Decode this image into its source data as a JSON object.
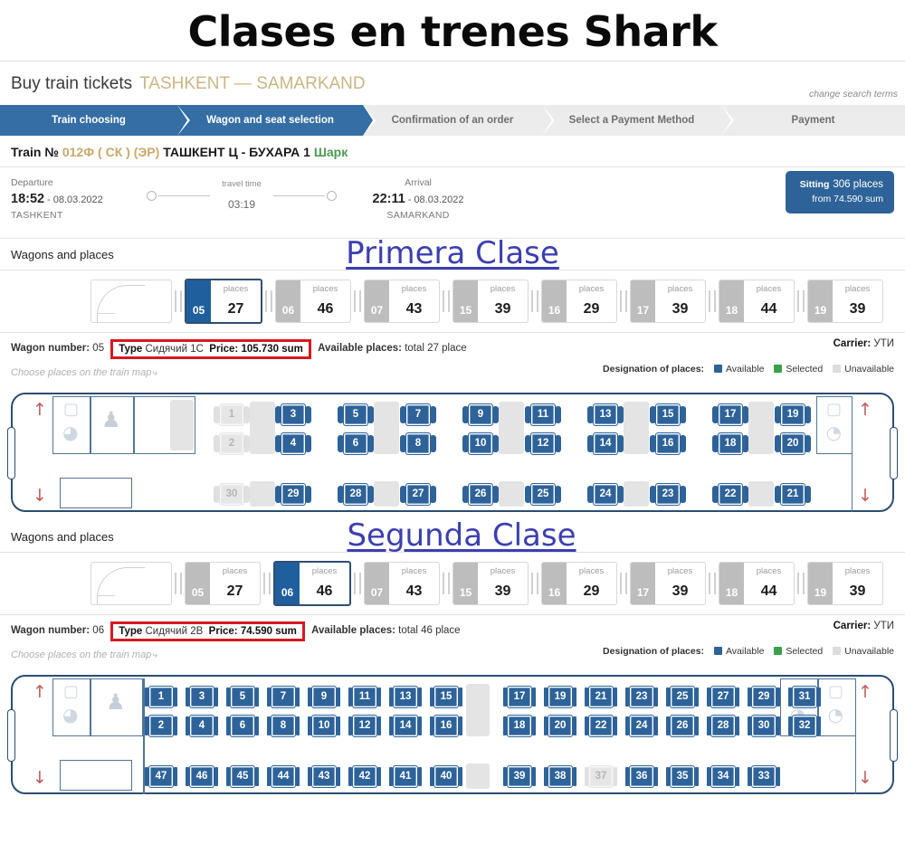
{
  "hero_title": "Clases en trenes Shark",
  "header": {
    "buy_label": "Buy train tickets",
    "route": "TASHKENT — SAMARKAND",
    "change_search": "change search terms"
  },
  "stepper": {
    "steps": [
      {
        "label": "Train choosing",
        "active": true
      },
      {
        "label": "Wagon and seat selection",
        "active": true
      },
      {
        "label": "Confirmation of an order",
        "active": false
      },
      {
        "label": "Select a Payment Method",
        "active": false
      },
      {
        "label": "Payment",
        "active": false
      }
    ]
  },
  "train": {
    "prefix": "Train №",
    "number": "012Ф ( СК ) (ЭР)",
    "route": "ТАШКЕНТ Ц - БУХАРА 1",
    "brand": "Шарк"
  },
  "schedule": {
    "departure_label": "Departure",
    "departure_time": "18:52",
    "departure_date": "- 08.03.2022",
    "departure_city": "TASHKENT",
    "travel_label": "travel time",
    "travel_time": "03:19",
    "arrival_label": "Arrival",
    "arrival_time": "22:11",
    "arrival_date": "- 08.03.2022",
    "arrival_city": "SAMARKAND",
    "badge_type": "Sitting",
    "badge_places": "306 places",
    "badge_price": "from 74.590 sum"
  },
  "legend": {
    "title": "Designation of places:",
    "available": "Available",
    "selected": "Selected",
    "unavailable": "Unavailable",
    "color_available": "#2e6399",
    "color_selected": "#3aa14a",
    "color_unavailable": "#dcdcdc"
  },
  "hint": "Choose places on the train map",
  "wagons_label": "Wagons and places",
  "section1": {
    "overlay_title": "Primera Clase",
    "wagons": [
      {
        "num": "05",
        "places_label": "places",
        "count": "27",
        "selected": true
      },
      {
        "num": "06",
        "places_label": "places",
        "count": "46",
        "selected": false
      },
      {
        "num": "07",
        "places_label": "places",
        "count": "43",
        "selected": false
      },
      {
        "num": "15",
        "places_label": "places",
        "count": "39",
        "selected": false
      },
      {
        "num": "16",
        "places_label": "places",
        "count": "29",
        "selected": false
      },
      {
        "num": "17",
        "places_label": "places",
        "count": "39",
        "selected": false
      },
      {
        "num": "18",
        "places_label": "places",
        "count": "44",
        "selected": false
      },
      {
        "num": "19",
        "places_label": "places",
        "count": "39",
        "selected": false
      }
    ],
    "info": {
      "wagon_number_label": "Wagon number:",
      "wagon_number": "05",
      "type_label": "Type",
      "type_value": "Сидячий 1С",
      "price_label": "Price:",
      "price_value": "105.730 sum",
      "available_label": "Available places:",
      "available_value": "total 27 place",
      "carrier_label": "Carrier:",
      "carrier_value": "УТИ"
    },
    "seatmap": {
      "top_rows": [
        [
          "1",
          "3",
          "5",
          "7",
          "9",
          "11",
          "13",
          "15",
          "17",
          "19"
        ],
        [
          "2",
          "4",
          "6",
          "8",
          "10",
          "12",
          "14",
          "16",
          "18",
          "20"
        ]
      ],
      "bottom_row": [
        "30",
        "29",
        "28",
        "27",
        "26",
        "25",
        "24",
        "23",
        "22",
        "21"
      ],
      "unavailable": [
        "1",
        "2",
        "30"
      ]
    }
  },
  "section2": {
    "overlay_title": "Segunda Clase",
    "wagons": [
      {
        "num": "05",
        "places_label": "places",
        "count": "27",
        "selected": false
      },
      {
        "num": "06",
        "places_label": "places",
        "count": "46",
        "selected": true
      },
      {
        "num": "07",
        "places_label": "places",
        "count": "43",
        "selected": false
      },
      {
        "num": "15",
        "places_label": "places",
        "count": "39",
        "selected": false
      },
      {
        "num": "16",
        "places_label": "places",
        "count": "29",
        "selected": false
      },
      {
        "num": "17",
        "places_label": "places",
        "count": "39",
        "selected": false
      },
      {
        "num": "18",
        "places_label": "places",
        "count": "44",
        "selected": false
      },
      {
        "num": "19",
        "places_label": "places",
        "count": "39",
        "selected": false
      }
    ],
    "info": {
      "wagon_number_label": "Wagon number:",
      "wagon_number": "06",
      "type_label": "Type",
      "type_value": "Сидячий 2В",
      "price_label": "Price:",
      "price_value": "74.590 sum",
      "available_label": "Available places:",
      "available_value": "total 46 place",
      "carrier_label": "Carrier:",
      "carrier_value": "УТИ"
    },
    "seatmap": {
      "top_rows": [
        [
          "1",
          "3",
          "5",
          "7",
          "9",
          "11",
          "13",
          "15",
          "17",
          "19",
          "21",
          "23",
          "25",
          "27",
          "29",
          "31"
        ],
        [
          "2",
          "4",
          "6",
          "8",
          "10",
          "12",
          "14",
          "16",
          "18",
          "20",
          "22",
          "24",
          "26",
          "28",
          "30",
          "32"
        ]
      ],
      "bottom_row": [
        "47",
        "46",
        "45",
        "44",
        "43",
        "42",
        "41",
        "40",
        "39",
        "38",
        "37",
        "36",
        "35",
        "34",
        "33"
      ],
      "unavailable": [
        "37"
      ]
    }
  },
  "icons": {
    "toilet": "toilet-icon",
    "sink": "sink-icon",
    "conductor": "conductor-icon",
    "arrow_up": "↑",
    "arrow_down": "↓",
    "curve": "↘"
  }
}
